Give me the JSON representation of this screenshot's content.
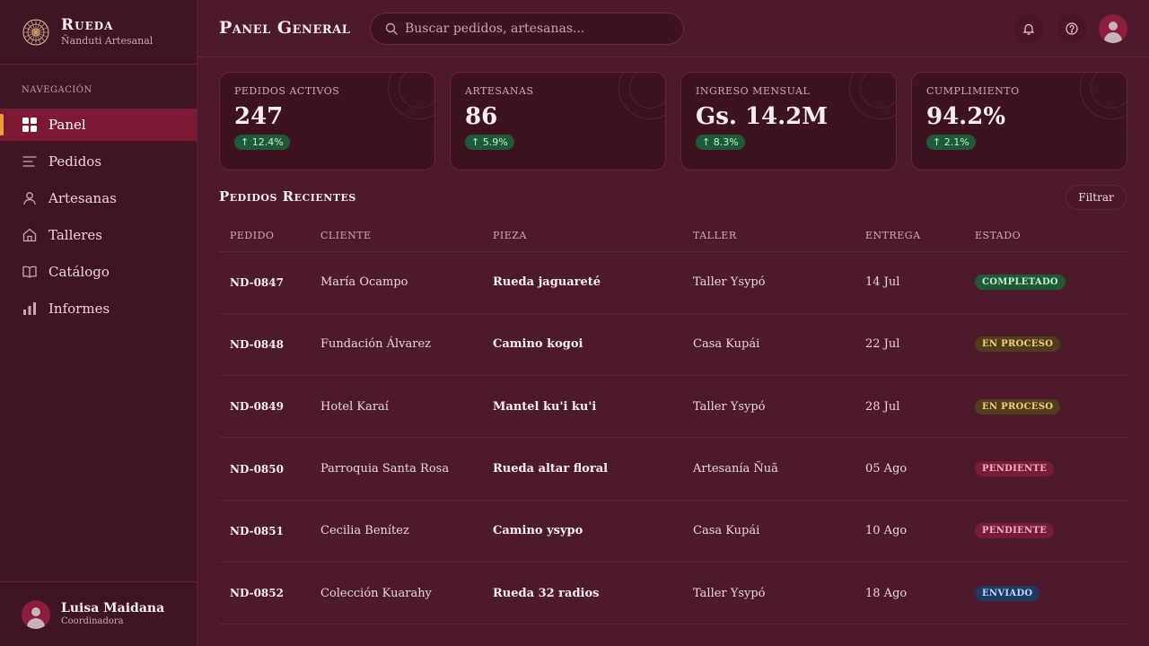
{
  "brand": {
    "title": "Rueda",
    "subtitle": "Ñanduti Artesanal"
  },
  "nav": {
    "heading": "NAVEGACIÓN",
    "items": [
      {
        "label": "Panel",
        "icon": "grid-icon",
        "active": true
      },
      {
        "label": "Pedidos",
        "icon": "list-icon",
        "active": false
      },
      {
        "label": "Artesanas",
        "icon": "user-icon",
        "active": false
      },
      {
        "label": "Talleres",
        "icon": "house-icon",
        "active": false
      },
      {
        "label": "Catálogo",
        "icon": "book-icon",
        "active": false
      },
      {
        "label": "Informes",
        "icon": "bar-chart-icon",
        "active": false
      }
    ]
  },
  "user": {
    "name": "Luisa Maidana",
    "role": "Coordinadora"
  },
  "header": {
    "title": "Panel General",
    "search_placeholder": "Buscar pedidos, artesanas..."
  },
  "stats": [
    {
      "label": "Pedidos activos",
      "value": "247",
      "delta": "↑ 12.4%"
    },
    {
      "label": "Artesanas",
      "value": "86",
      "delta": "↑ 5.9%"
    },
    {
      "label": "Ingreso mensual",
      "value": "Gs. 14.2M",
      "delta": "↑ 8.3%"
    },
    {
      "label": "Cumplimiento",
      "value": "94.2%",
      "delta": "↑ 2.1%"
    }
  ],
  "orders": {
    "title": "Pedidos Recientes",
    "filter_label": "Filtrar",
    "columns": [
      "Pedido",
      "Cliente",
      "Pieza",
      "Taller",
      "Entrega",
      "Estado"
    ],
    "rows": [
      {
        "id": "ND-0847",
        "client": "María Ocampo",
        "piece": "Rueda jaguareté",
        "workshop": "Taller Ysypó",
        "delivery": "14 Jul",
        "status": "Completado",
        "status_key": "completed"
      },
      {
        "id": "ND-0848",
        "client": "Fundación Álvarez",
        "piece": "Camino kogoi",
        "workshop": "Casa Kupái",
        "delivery": "22 Jul",
        "status": "En proceso",
        "status_key": "progress"
      },
      {
        "id": "ND-0849",
        "client": "Hotel Karaí",
        "piece": "Mantel ku'i ku'i",
        "workshop": "Taller Ysypó",
        "delivery": "28 Jul",
        "status": "En proceso",
        "status_key": "progress"
      },
      {
        "id": "ND-0850",
        "client": "Parroquia Santa Rosa",
        "piece": "Rueda altar floral",
        "workshop": "Artesanía Ñuã",
        "delivery": "05 Ago",
        "status": "Pendiente",
        "status_key": "pending"
      },
      {
        "id": "ND-0851",
        "client": "Cecilia Benítez",
        "piece": "Camino ysypo",
        "workshop": "Casa Kupái",
        "delivery": "10 Ago",
        "status": "Pendiente",
        "status_key": "pending"
      },
      {
        "id": "ND-0852",
        "client": "Colección Kuarahy",
        "piece": "Rueda 32 radios",
        "workshop": "Taller Ysypó",
        "delivery": "18 Ago",
        "status": "Enviado",
        "status_key": "shipped"
      }
    ]
  },
  "colors": {
    "accent": "#e8a13a",
    "active_nav": "#7c1a35",
    "status": {
      "completed": {
        "bg": "#1f5a36",
        "fg": "#bff0cf"
      },
      "progress": {
        "bg": "#4f3d1c",
        "fg": "#f4d27a"
      },
      "pending": {
        "bg": "#7a1c36",
        "fg": "#f2b3c3"
      },
      "shipped": {
        "bg": "#1f3860",
        "fg": "#c3d8ff"
      }
    }
  }
}
